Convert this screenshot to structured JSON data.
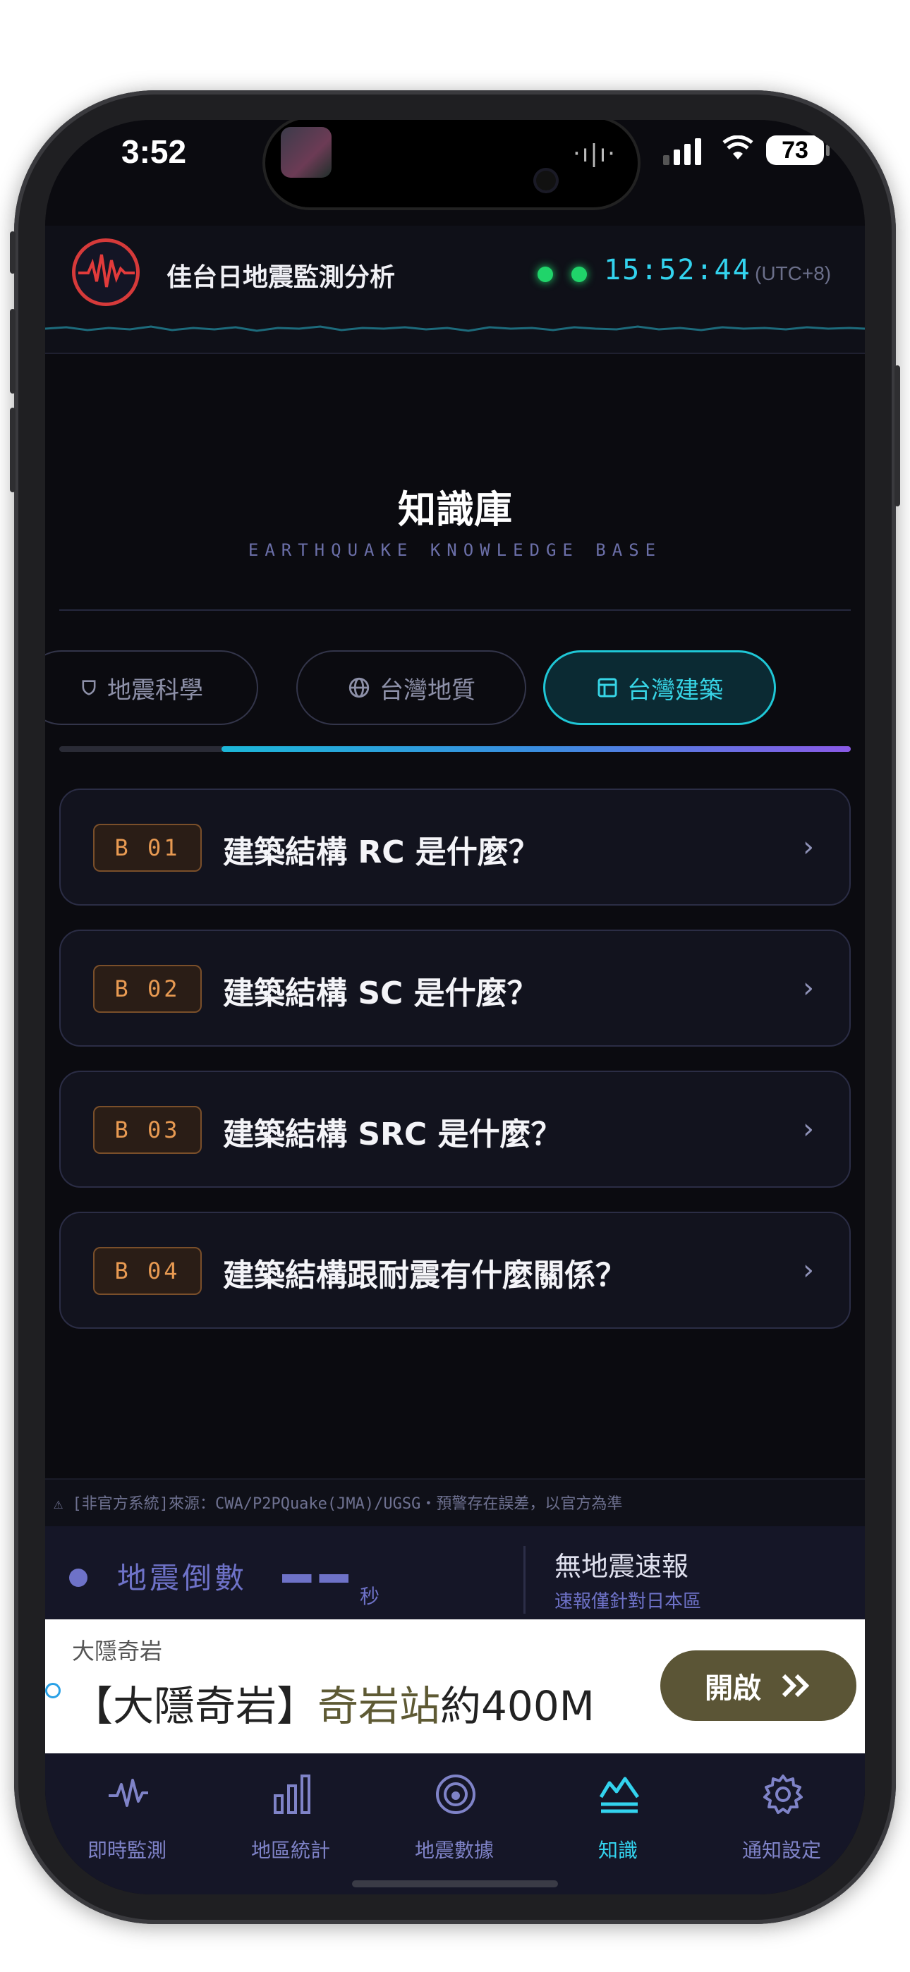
{
  "status_bar": {
    "time": "3:52",
    "battery": "73"
  },
  "header": {
    "app_title": "佳台日地震監測分析",
    "clock": "15:52:44",
    "timezone": "(UTC+8)"
  },
  "knowledge": {
    "title": "知識庫",
    "subtitle": "EARTHQUAKE KNOWLEDGE BASE"
  },
  "category_tabs": [
    {
      "label": "地震科學",
      "icon": "shield-icon",
      "active": false
    },
    {
      "label": "台灣地質",
      "icon": "globe-icon",
      "active": false
    },
    {
      "label": "台灣建築",
      "icon": "layout-icon",
      "active": true
    }
  ],
  "articles": [
    {
      "code": "B 01",
      "title": "建築結構 RC 是什麼？"
    },
    {
      "code": "B 02",
      "title": "建築結構 SC 是什麼？"
    },
    {
      "code": "B 03",
      "title": "建築結構 SRC 是什麼？"
    },
    {
      "code": "B 04",
      "title": "建築結構跟耐震有什麼關係？"
    }
  ],
  "disclaimer": "⚠ [非官方系統]來源：CWA/P2PQuake(JMA)/UGSG・預警存在誤差，以官方為準",
  "countdown": {
    "label": "地震倒數",
    "unit": "秒"
  },
  "eew": {
    "status": "無地震速報",
    "note": "速報僅針對日本區"
  },
  "ad": {
    "brand": "大隱奇岩",
    "text_prefix": "【大隱奇岩】",
    "text_highlight": "奇岩站",
    "text_suffix": "約400M",
    "button": "開啟"
  },
  "tab_bar": [
    {
      "label": "即時監測",
      "icon": "pulse-icon",
      "active": false
    },
    {
      "label": "地區統計",
      "icon": "bar-chart-icon",
      "active": false
    },
    {
      "label": "地震數據",
      "icon": "target-icon",
      "active": false
    },
    {
      "label": "知識",
      "icon": "knowledge-icon",
      "active": true
    },
    {
      "label": "通知設定",
      "icon": "gear-icon",
      "active": false
    }
  ],
  "colors": {
    "accent_cyan": "#33d3ee",
    "live_green": "#20d46a",
    "badge_orange": "#e89a52",
    "tab_purple": "#7f83c8"
  }
}
